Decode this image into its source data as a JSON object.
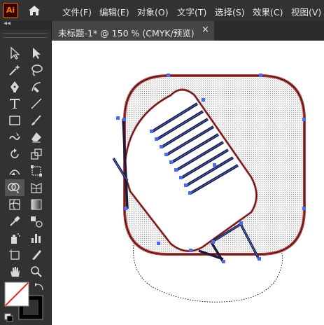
{
  "app": {
    "logo_text": "Ai",
    "home_icon": "home-icon"
  },
  "menu": [
    "文件(F)",
    "编辑(E)",
    "对象(O)",
    "文字(T)",
    "选择(S)",
    "效果(C)",
    "视图(V)"
  ],
  "document_tab": {
    "title": "未标题-1* @ 150 % (CMYK/预览)",
    "close": "×"
  },
  "toolbar": {
    "collapse_label": "◂◂",
    "tools": [
      "selection-tool",
      "direct-selection-tool",
      "magic-wand-tool",
      "lasso-tool",
      "pen-tool",
      "curvature-tool",
      "type-tool",
      "line-segment-tool",
      "rectangle-tool",
      "paintbrush-tool",
      "shaper-tool",
      "eraser-tool",
      "rotate-tool",
      "scale-tool",
      "width-tool",
      "free-transform-tool",
      "shape-builder-tool",
      "perspective-grid-tool",
      "mesh-tool",
      "gradient-tool",
      "eyedropper-tool",
      "blend-tool",
      "symbol-sprayer-tool",
      "column-graph-tool",
      "artboard-tool",
      "slice-tool",
      "hand-tool",
      "zoom-tool"
    ],
    "active_tool": "shape-builder-tool"
  },
  "colors": {
    "menubar": "#323232",
    "toolbar": "#323232",
    "canvas": "#ffffff",
    "path_selection": "#4a6cf0",
    "shape_outline": "#c43b3b",
    "stroke": "#1a1a1a"
  }
}
